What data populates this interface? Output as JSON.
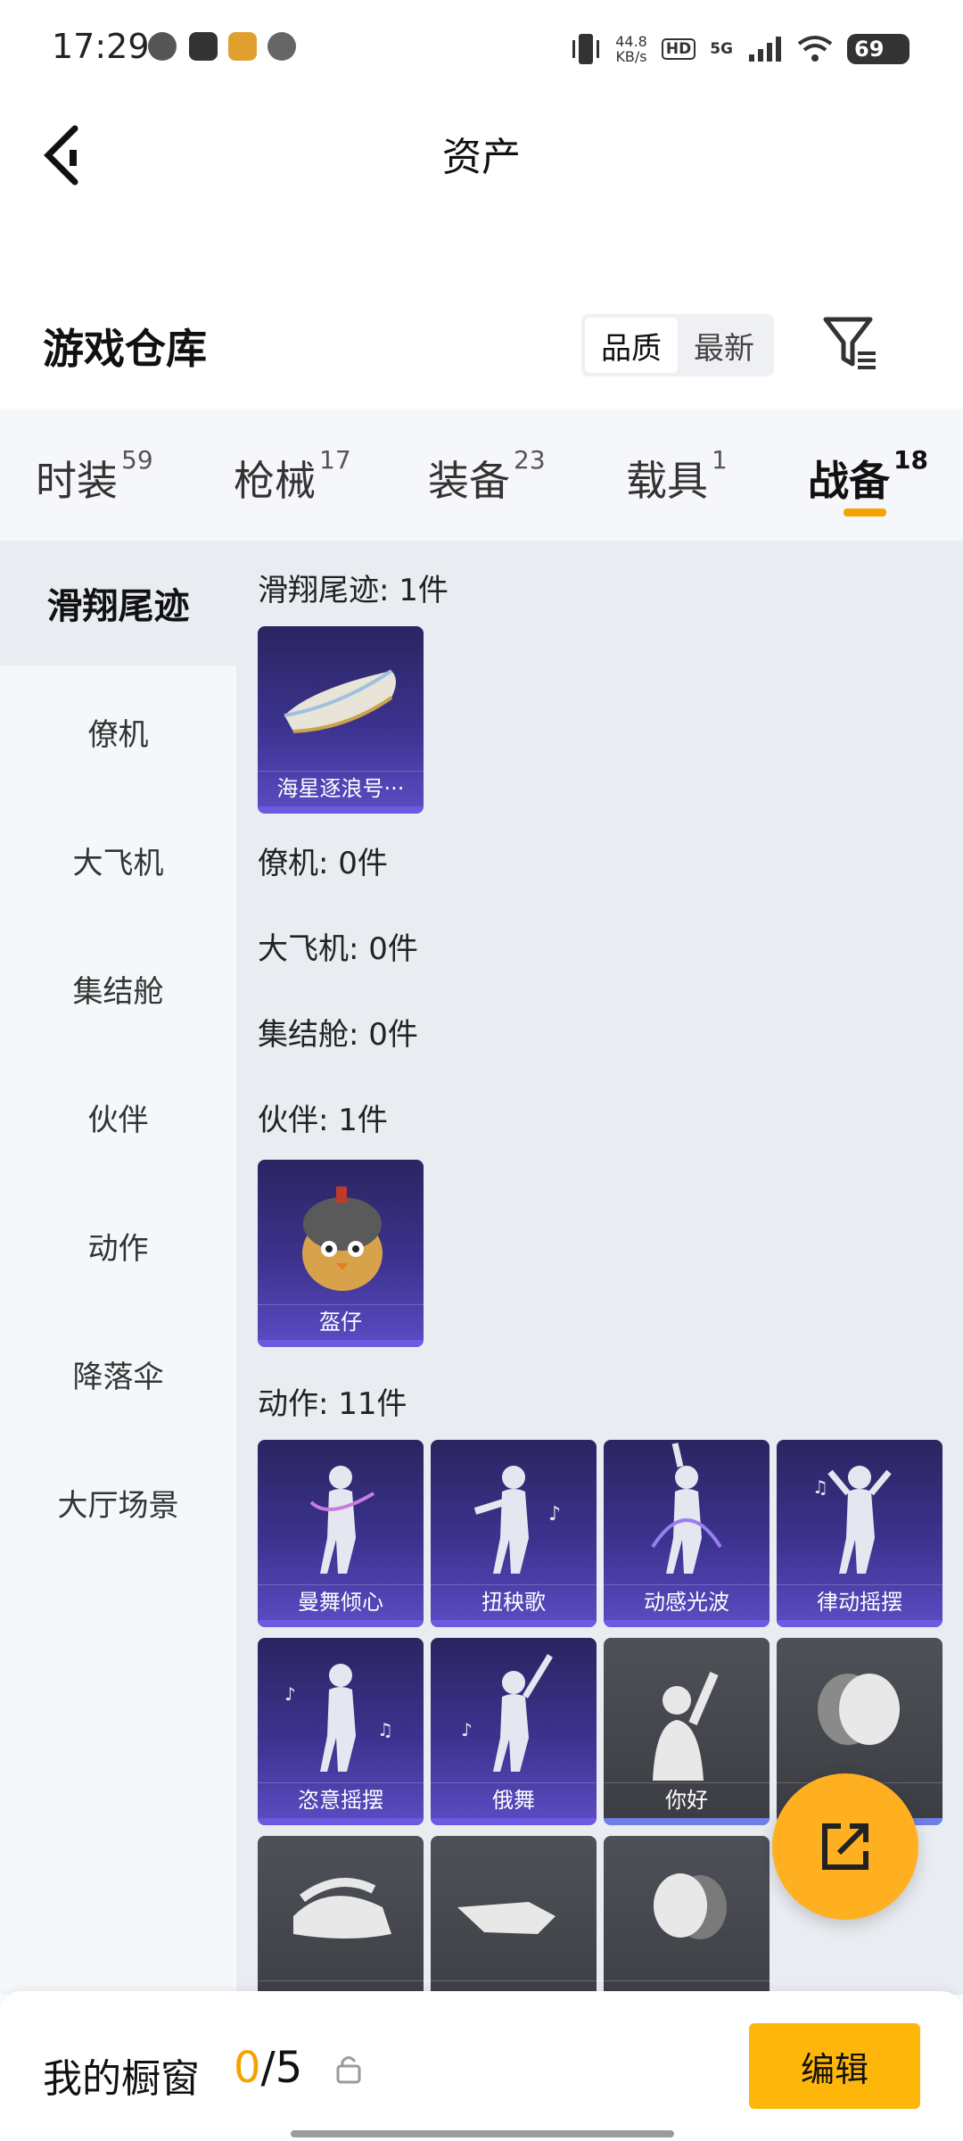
{
  "status_bar": {
    "time": "17:29",
    "net_speed_value": "44.8",
    "net_speed_unit": "KB/s",
    "hd": "HD",
    "signal": "5G",
    "battery": "69"
  },
  "nav": {
    "title": "资产",
    "back_icon": "back-arrow-icon"
  },
  "warehouse": {
    "title": "游戏仓库",
    "sort_options": [
      "品质",
      "最新"
    ],
    "sort_selected": "品质",
    "filter_icon": "filter-icon"
  },
  "tabs": [
    {
      "label": "时装",
      "count": "59"
    },
    {
      "label": "枪械",
      "count": "17"
    },
    {
      "label": "装备",
      "count": "23"
    },
    {
      "label": "载具",
      "count": "1"
    },
    {
      "label": "战备",
      "count": "18",
      "active": true
    }
  ],
  "sidebar": [
    {
      "label": "滑翔尾迹",
      "active": true
    },
    {
      "label": "僚机"
    },
    {
      "label": "大飞机"
    },
    {
      "label": "集结舱"
    },
    {
      "label": "伙伴"
    },
    {
      "label": "动作"
    },
    {
      "label": "降落伞"
    },
    {
      "label": "大厅场景"
    }
  ],
  "sections": [
    {
      "label": "滑翔尾迹: 1件",
      "items": [
        "海星逐浪号···"
      ]
    },
    {
      "label": "僚机: 0件",
      "items": []
    },
    {
      "label": "大飞机: 0件",
      "items": []
    },
    {
      "label": "集结舱: 0件",
      "items": []
    },
    {
      "label": "伙伴: 1件",
      "items": [
        "盔仔"
      ]
    },
    {
      "label": "动作: 11件",
      "items": [
        "曼舞倾心",
        "扭秧歌",
        "动感光波",
        "律动摇摆",
        "恣意摇摆",
        "俄舞",
        "你好",
        "",
        "",
        "",
        ""
      ]
    }
  ],
  "bottom": {
    "title": "我的橱窗",
    "count_current": "0",
    "count_total": "/5",
    "edit_label": "编辑"
  },
  "colors": {
    "accent": "#f5a300",
    "edit_button": "#ffb60a",
    "card_purple": "#3d3390",
    "card_gray": "#4a4c52"
  }
}
